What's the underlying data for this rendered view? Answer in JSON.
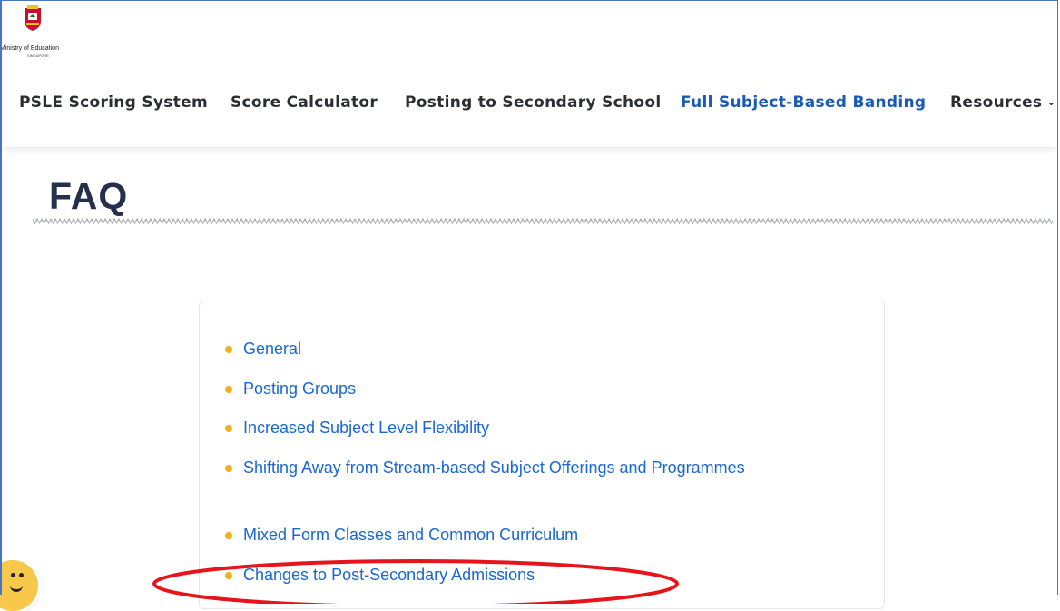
{
  "logo": {
    "name": "crest-logo",
    "line1": "Ministry of Education",
    "line2": "SINGAPORE"
  },
  "nav": {
    "items": [
      {
        "label": "PSLE Scoring System"
      },
      {
        "label": "Score Calculator"
      },
      {
        "label": "Posting to Secondary School"
      },
      {
        "label": "Full Subject-Based Banding",
        "active": true
      },
      {
        "label": "Resources"
      }
    ]
  },
  "page": {
    "title": "FAQ"
  },
  "faq": {
    "items": [
      {
        "label": "General"
      },
      {
        "label": "Posting Groups"
      },
      {
        "label": "Increased Subject Level Flexibility"
      },
      {
        "label": "Shifting Away from Stream-based Subject Offerings and Programmes"
      },
      {
        "label": "Mixed Form Classes and Common Curriculum"
      },
      {
        "label": "Changes to Post-Secondary Admissions",
        "highlighted": true
      }
    ]
  },
  "colors": {
    "link": "#1a67d2",
    "active_nav": "#1a5ab8",
    "bullet": "#f2b01e",
    "annotation": "#e8141b",
    "title": "#26304a"
  },
  "icons": {
    "nav_dropdown": "chevron-down-icon",
    "chat": "chat-smiley-icon"
  }
}
